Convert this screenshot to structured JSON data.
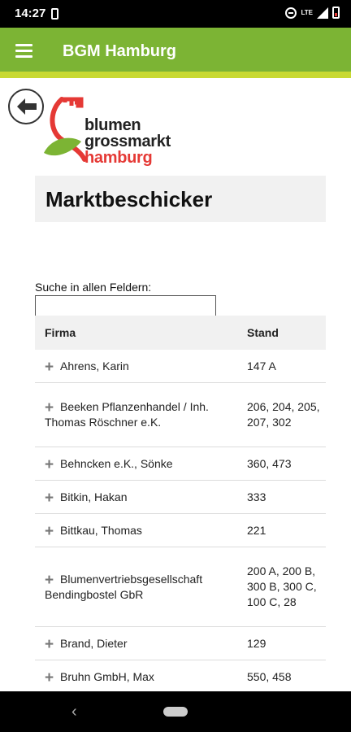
{
  "status_bar": {
    "time": "14:27",
    "lte_label": "LTE",
    "icons": [
      "battery-saver-icon",
      "dnd-icon",
      "lte-icon",
      "signal-icon",
      "battery-icon"
    ]
  },
  "app_bar": {
    "title": "BGM Hamburg",
    "background_color": "#7cb434",
    "accent_color": "#c8d932"
  },
  "logo": {
    "line1": "blumen",
    "line2": "grossmarkt",
    "line3": "hamburg",
    "red_color": "#e53935",
    "green_color": "#7cb434"
  },
  "page": {
    "title": "Marktbeschicker"
  },
  "search": {
    "label": "Suche in allen Feldern:",
    "value": "",
    "placeholder": ""
  },
  "table": {
    "headers": [
      "Firma",
      "Stand"
    ],
    "rows": [
      {
        "firma": "Ahrens, Karin",
        "stand": "147 A"
      },
      {
        "firma": "Beeken Pflanzenhandel / Inh. Thomas Röschner e.K.",
        "stand": "206, 204, 205, 207, 302"
      },
      {
        "firma": "Behncken e.K., Sönke",
        "stand": "360, 473"
      },
      {
        "firma": "Bitkin, Hakan",
        "stand": "333"
      },
      {
        "firma": "Bittkau, Thomas",
        "stand": "221"
      },
      {
        "firma": "Blumenvertriebsgesellschaft Bendingbostel GbR",
        "stand": "200 A, 200 B, 300 B, 300 C, 100 C, 28"
      },
      {
        "firma": "Brand, Dieter",
        "stand": "129"
      },
      {
        "firma": "Bruhn GmbH, Max",
        "stand": "550, 458"
      }
    ]
  },
  "nav_bar": {
    "back_icon": "nav-back-icon",
    "home_icon": "nav-home-pill-icon"
  }
}
